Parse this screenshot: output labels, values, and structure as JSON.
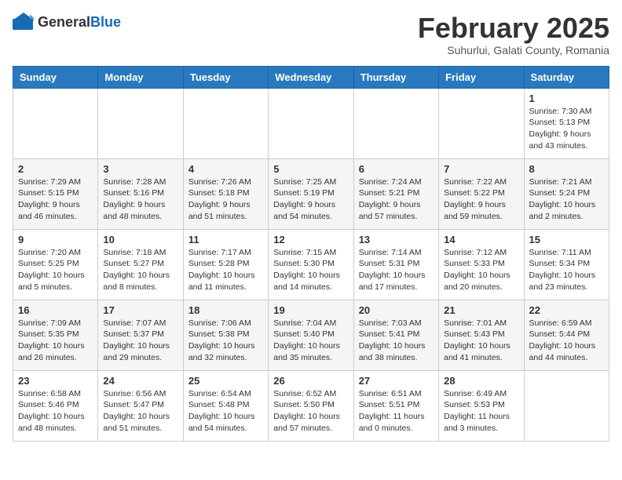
{
  "header": {
    "logo": {
      "general": "General",
      "blue": "Blue"
    },
    "month": "February 2025",
    "location": "Suhurlui, Galati County, Romania"
  },
  "weekdays": [
    "Sunday",
    "Monday",
    "Tuesday",
    "Wednesday",
    "Thursday",
    "Friday",
    "Saturday"
  ],
  "weeks": [
    [
      {
        "day": "",
        "info": ""
      },
      {
        "day": "",
        "info": ""
      },
      {
        "day": "",
        "info": ""
      },
      {
        "day": "",
        "info": ""
      },
      {
        "day": "",
        "info": ""
      },
      {
        "day": "",
        "info": ""
      },
      {
        "day": "1",
        "info": "Sunrise: 7:30 AM\nSunset: 5:13 PM\nDaylight: 9 hours and 43 minutes."
      }
    ],
    [
      {
        "day": "2",
        "info": "Sunrise: 7:29 AM\nSunset: 5:15 PM\nDaylight: 9 hours and 46 minutes."
      },
      {
        "day": "3",
        "info": "Sunrise: 7:28 AM\nSunset: 5:16 PM\nDaylight: 9 hours and 48 minutes."
      },
      {
        "day": "4",
        "info": "Sunrise: 7:26 AM\nSunset: 5:18 PM\nDaylight: 9 hours and 51 minutes."
      },
      {
        "day": "5",
        "info": "Sunrise: 7:25 AM\nSunset: 5:19 PM\nDaylight: 9 hours and 54 minutes."
      },
      {
        "day": "6",
        "info": "Sunrise: 7:24 AM\nSunset: 5:21 PM\nDaylight: 9 hours and 57 minutes."
      },
      {
        "day": "7",
        "info": "Sunrise: 7:22 AM\nSunset: 5:22 PM\nDaylight: 9 hours and 59 minutes."
      },
      {
        "day": "8",
        "info": "Sunrise: 7:21 AM\nSunset: 5:24 PM\nDaylight: 10 hours and 2 minutes."
      }
    ],
    [
      {
        "day": "9",
        "info": "Sunrise: 7:20 AM\nSunset: 5:25 PM\nDaylight: 10 hours and 5 minutes."
      },
      {
        "day": "10",
        "info": "Sunrise: 7:18 AM\nSunset: 5:27 PM\nDaylight: 10 hours and 8 minutes."
      },
      {
        "day": "11",
        "info": "Sunrise: 7:17 AM\nSunset: 5:28 PM\nDaylight: 10 hours and 11 minutes."
      },
      {
        "day": "12",
        "info": "Sunrise: 7:15 AM\nSunset: 5:30 PM\nDaylight: 10 hours and 14 minutes."
      },
      {
        "day": "13",
        "info": "Sunrise: 7:14 AM\nSunset: 5:31 PM\nDaylight: 10 hours and 17 minutes."
      },
      {
        "day": "14",
        "info": "Sunrise: 7:12 AM\nSunset: 5:33 PM\nDaylight: 10 hours and 20 minutes."
      },
      {
        "day": "15",
        "info": "Sunrise: 7:11 AM\nSunset: 5:34 PM\nDaylight: 10 hours and 23 minutes."
      }
    ],
    [
      {
        "day": "16",
        "info": "Sunrise: 7:09 AM\nSunset: 5:35 PM\nDaylight: 10 hours and 26 minutes."
      },
      {
        "day": "17",
        "info": "Sunrise: 7:07 AM\nSunset: 5:37 PM\nDaylight: 10 hours and 29 minutes."
      },
      {
        "day": "18",
        "info": "Sunrise: 7:06 AM\nSunset: 5:38 PM\nDaylight: 10 hours and 32 minutes."
      },
      {
        "day": "19",
        "info": "Sunrise: 7:04 AM\nSunset: 5:40 PM\nDaylight: 10 hours and 35 minutes."
      },
      {
        "day": "20",
        "info": "Sunrise: 7:03 AM\nSunset: 5:41 PM\nDaylight: 10 hours and 38 minutes."
      },
      {
        "day": "21",
        "info": "Sunrise: 7:01 AM\nSunset: 5:43 PM\nDaylight: 10 hours and 41 minutes."
      },
      {
        "day": "22",
        "info": "Sunrise: 6:59 AM\nSunset: 5:44 PM\nDaylight: 10 hours and 44 minutes."
      }
    ],
    [
      {
        "day": "23",
        "info": "Sunrise: 6:58 AM\nSunset: 5:46 PM\nDaylight: 10 hours and 48 minutes."
      },
      {
        "day": "24",
        "info": "Sunrise: 6:56 AM\nSunset: 5:47 PM\nDaylight: 10 hours and 51 minutes."
      },
      {
        "day": "25",
        "info": "Sunrise: 6:54 AM\nSunset: 5:48 PM\nDaylight: 10 hours and 54 minutes."
      },
      {
        "day": "26",
        "info": "Sunrise: 6:52 AM\nSunset: 5:50 PM\nDaylight: 10 hours and 57 minutes."
      },
      {
        "day": "27",
        "info": "Sunrise: 6:51 AM\nSunset: 5:51 PM\nDaylight: 11 hours and 0 minutes."
      },
      {
        "day": "28",
        "info": "Sunrise: 6:49 AM\nSunset: 5:53 PM\nDaylight: 11 hours and 3 minutes."
      },
      {
        "day": "",
        "info": ""
      }
    ]
  ]
}
